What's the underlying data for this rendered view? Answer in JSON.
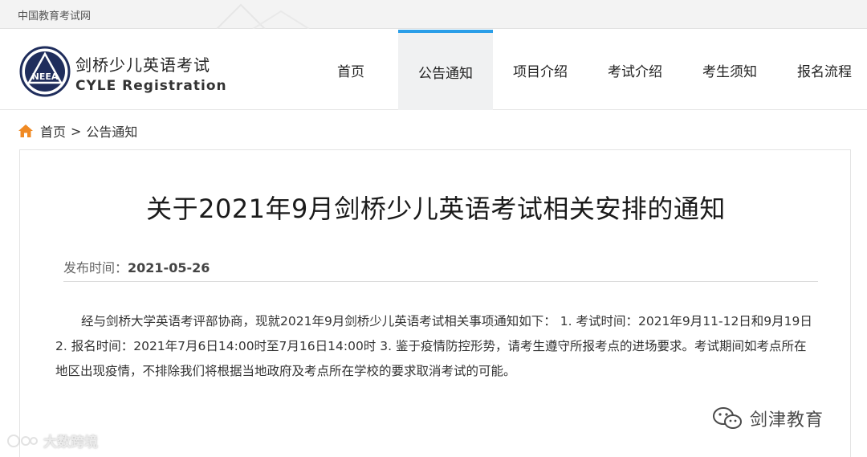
{
  "topbar": {
    "site_name": "中国教育考试网"
  },
  "header": {
    "logo_text": "NEEA",
    "brand_cn": "剑桥少儿英语考试",
    "brand_en": "CYLE Registration"
  },
  "nav": {
    "items": [
      {
        "label": "首页",
        "active": false
      },
      {
        "label": "公告通知",
        "active": true
      },
      {
        "label": "项目介绍",
        "active": false
      },
      {
        "label": "考试介绍",
        "active": false
      },
      {
        "label": "考生须知",
        "active": false
      },
      {
        "label": "报名流程",
        "active": false
      }
    ]
  },
  "breadcrumb": {
    "home": "首页",
    "separator": ">",
    "current": "公告通知"
  },
  "article": {
    "title": "关于2021年9月剑桥少儿英语考试相关安排的通知",
    "published_label": "发布时间：",
    "published_date": "2021-05-26",
    "body": "经与剑桥大学英语考评部协商，现就2021年9月剑桥少儿英语考试相关事项通知如下： 1. 考试时间：2021年9月11-12日和9月19日 2. 报名时间：2021年7月6日14:00时至7月16日14:00时 3. 鉴于疫情防控形势，请考生遵守所报考点的进场要求。考试期间如考点所在地区出现疫情，不排除我们将根据当地政府及考点所在学校的要求取消考试的可能。"
  },
  "watermarks": {
    "left": "大数跨境",
    "right": "剑津教育"
  },
  "colors": {
    "accent": "#2a9ee8",
    "home_icon": "#f08a24",
    "logo_navy": "#1f2d5c"
  }
}
